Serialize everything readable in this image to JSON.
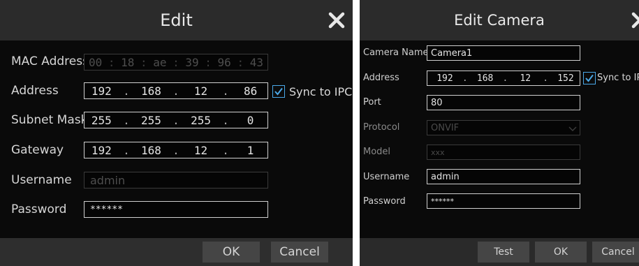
{
  "edit_dialog": {
    "title": "Edit",
    "mac_label": "MAC Address",
    "mac": [
      "00",
      "18",
      "ae",
      "39",
      "96",
      "43"
    ],
    "address_label": "Address",
    "address": [
      "192",
      "168",
      "12",
      "86"
    ],
    "sync_label": "Sync to IPC",
    "subnet_label": "Subnet Mask",
    "subnet": [
      "255",
      "255",
      "255",
      "0"
    ],
    "gateway_label": "Gateway",
    "gateway": [
      "192",
      "168",
      "12",
      "1"
    ],
    "username_label": "Username",
    "username": "admin",
    "password_label": "Password",
    "password": "******",
    "ok": "OK",
    "cancel": "Cancel"
  },
  "edit_camera_dialog": {
    "title": "Edit Camera",
    "name_label": "Camera Name",
    "name": "Camera1",
    "address_label": "Address",
    "address": [
      "192",
      "168",
      "12",
      "152"
    ],
    "sync_label": "Sync to IPC",
    "port_label": "Port",
    "port": "80",
    "protocol_label": "Protocol",
    "protocol": "ONVIF",
    "model_label": "Model",
    "model": "xxx",
    "username_label": "Username",
    "username": "admin",
    "password_label": "Password",
    "password": "******",
    "test": "Test",
    "ok": "OK",
    "cancel": "Cancel"
  },
  "colors": {
    "accent": "#4aa8e8",
    "dialog_bg": "#0a0a0a",
    "title_bg": "#2b2b2b"
  }
}
